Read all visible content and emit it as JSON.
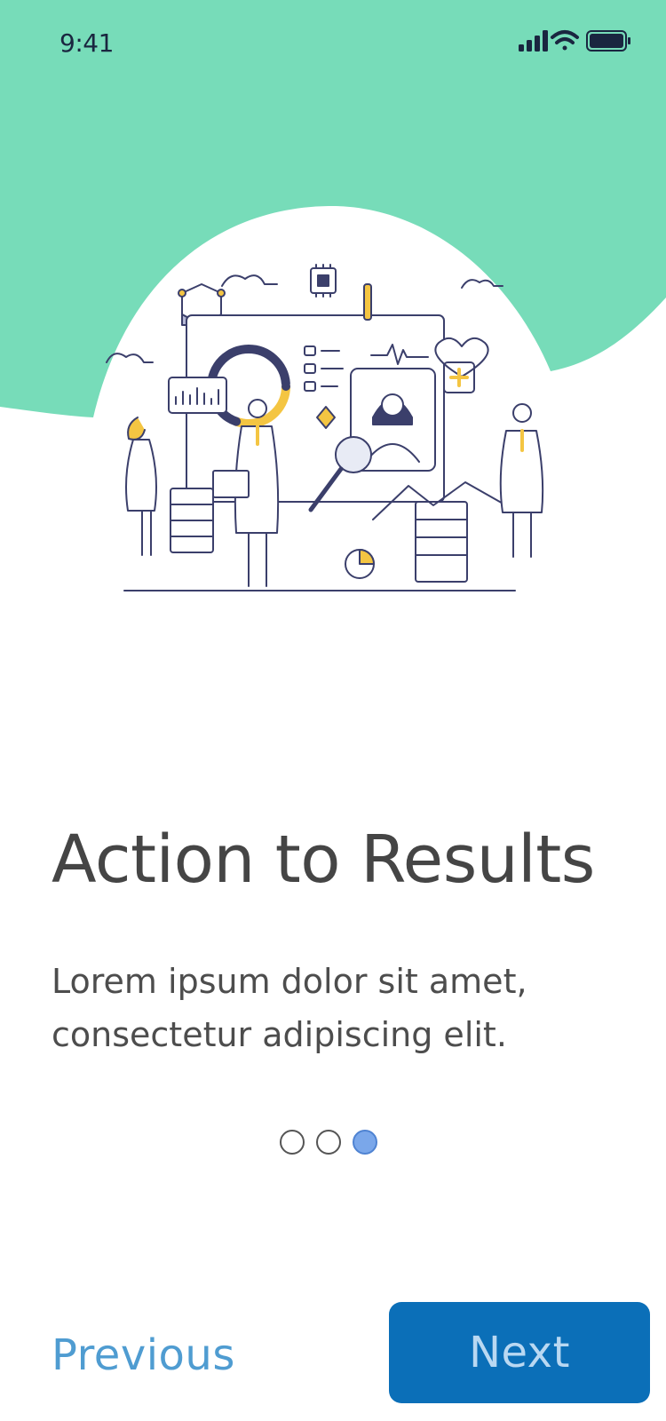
{
  "status_bar": {
    "time": "9:41",
    "signal_icon": "cellular-signal-icon",
    "wifi_icon": "wifi-icon",
    "battery_icon": "battery-icon"
  },
  "illustration": {
    "icon": "data-science-team-illustration"
  },
  "onboarding": {
    "title": "Action to Results",
    "body": "Lorem ipsum dolor sit amet, consectetur adipiscing elit.",
    "pages": 3,
    "current_page": 3
  },
  "nav": {
    "previous_label": "Previous",
    "next_label": "Next"
  },
  "colors": {
    "accent_mint": "#77dcb9",
    "primary_blue": "#0b6fb8",
    "link_blue": "#4f9cd1",
    "dot_active": "#7aa7ea"
  }
}
